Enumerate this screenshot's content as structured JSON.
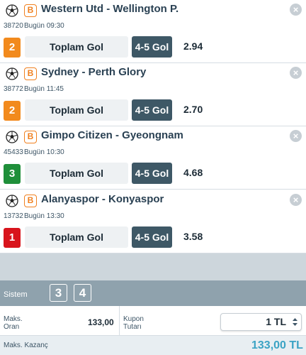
{
  "bets": [
    {
      "teams": "Western Utd - Wellington P.",
      "code": "38720",
      "time": "Bugün 09:30",
      "number": "2",
      "number_color": "#f28a1d",
      "market": "Toplam Gol",
      "selection": "4-5 Gol",
      "odd": "2.94",
      "sport_icon": "soccer-ball-icon",
      "badge": "B"
    },
    {
      "teams": "Sydney - Perth Glory",
      "code": "38772",
      "time": "Bugün 11:45",
      "number": "2",
      "number_color": "#f28a1d",
      "market": "Toplam Gol",
      "selection": "4-5 Gol",
      "odd": "2.70",
      "sport_icon": "soccer-ball-icon",
      "badge": "B"
    },
    {
      "teams": "Gimpo Citizen - Gyeongnam",
      "code": "45433",
      "time": "Bugün 10:30",
      "number": "3",
      "number_color": "#1f8f3a",
      "market": "Toplam Gol",
      "selection": "4-5 Gol",
      "odd": "4.68",
      "sport_icon": "soccer-ball-icon",
      "badge": "B"
    },
    {
      "teams": "Alanyaspor - Konyaspor",
      "code": "13732",
      "time": "Bugün 13:30",
      "number": "1",
      "number_color": "#d8141c",
      "market": "Toplam Gol",
      "selection": "4-5 Gol",
      "odd": "3.58",
      "sport_icon": "soccer-ball-icon",
      "badge": "B"
    }
  ],
  "sistem": {
    "label": "Sistem",
    "options": [
      "3",
      "4"
    ]
  },
  "summary": {
    "maks_oran_label": "Maks. Oran",
    "maks_oran_value": "133,00",
    "kupon_tutari_label": "Kupon Tutarı",
    "stake_value": "1 TL",
    "maks_kazanc_label": "Maks. Kazanç",
    "maks_kazanc_value": "133,00 TL"
  },
  "colors": {
    "accent": "#3ba3c4",
    "selection_bg": "#3e5866",
    "sistem_bar": "#8fa2ad"
  }
}
